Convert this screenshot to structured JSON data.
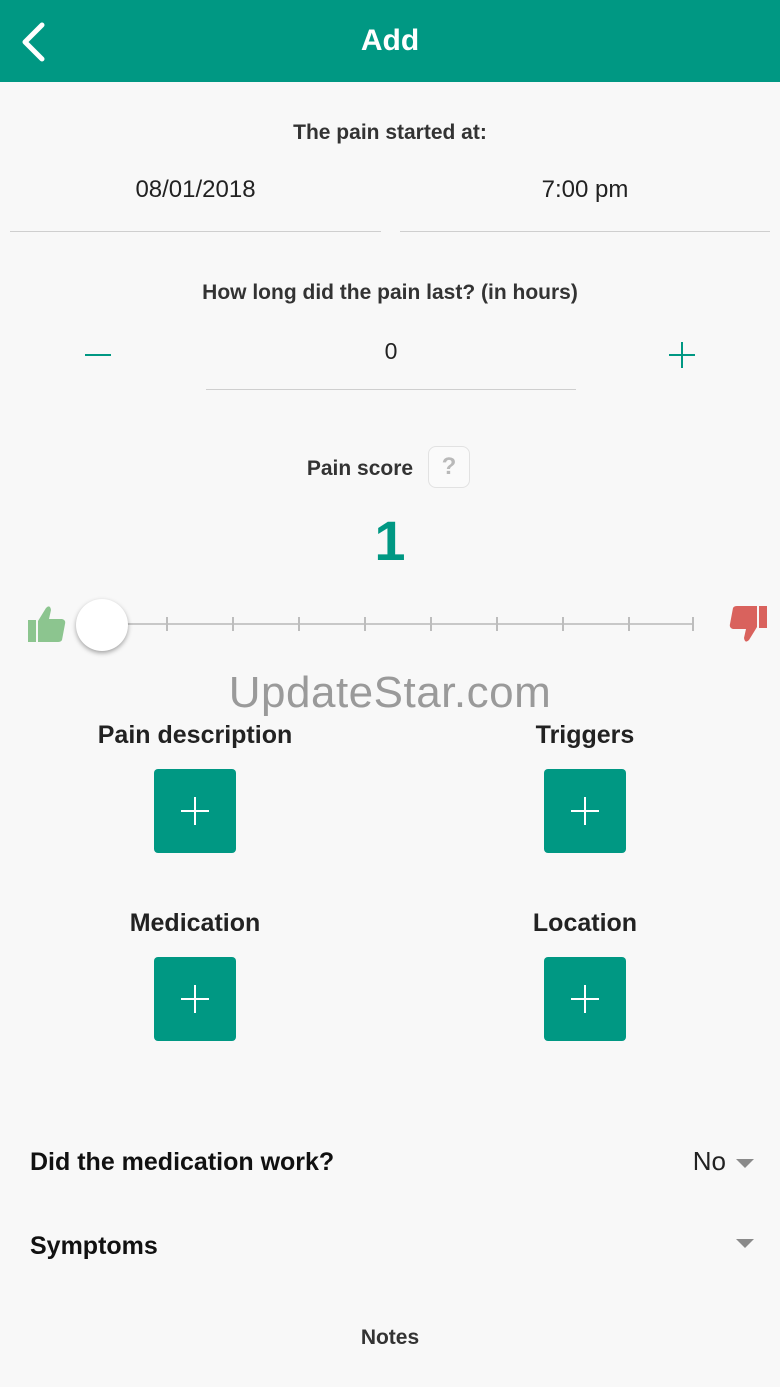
{
  "header": {
    "title": "Add"
  },
  "start": {
    "label": "The pain started at:",
    "date": "08/01/2018",
    "time": "7:00 pm"
  },
  "duration": {
    "label": "How long did the pain last? (in hours)",
    "value": "0"
  },
  "pain_score": {
    "label": "Pain score",
    "help": "?",
    "value": "1",
    "slider_fraction": 0.0
  },
  "watermark": "UpdateStar.com",
  "categories": {
    "pain_description": "Pain description",
    "triggers": "Triggers",
    "medication": "Medication",
    "location": "Location"
  },
  "medication_work": {
    "label": "Did the medication work?",
    "value": "No"
  },
  "symptoms": {
    "label": "Symptoms"
  },
  "notes": {
    "label": "Notes"
  },
  "colors": {
    "accent": "#009883",
    "thumbs_up": "#8cc58f",
    "thumbs_down": "#d9625d"
  },
  "icons": [
    "back-arrow-icon",
    "minus-icon",
    "plus-icon",
    "help-icon",
    "thumbs-up-icon",
    "thumbs-down-icon",
    "caret-down-icon"
  ]
}
